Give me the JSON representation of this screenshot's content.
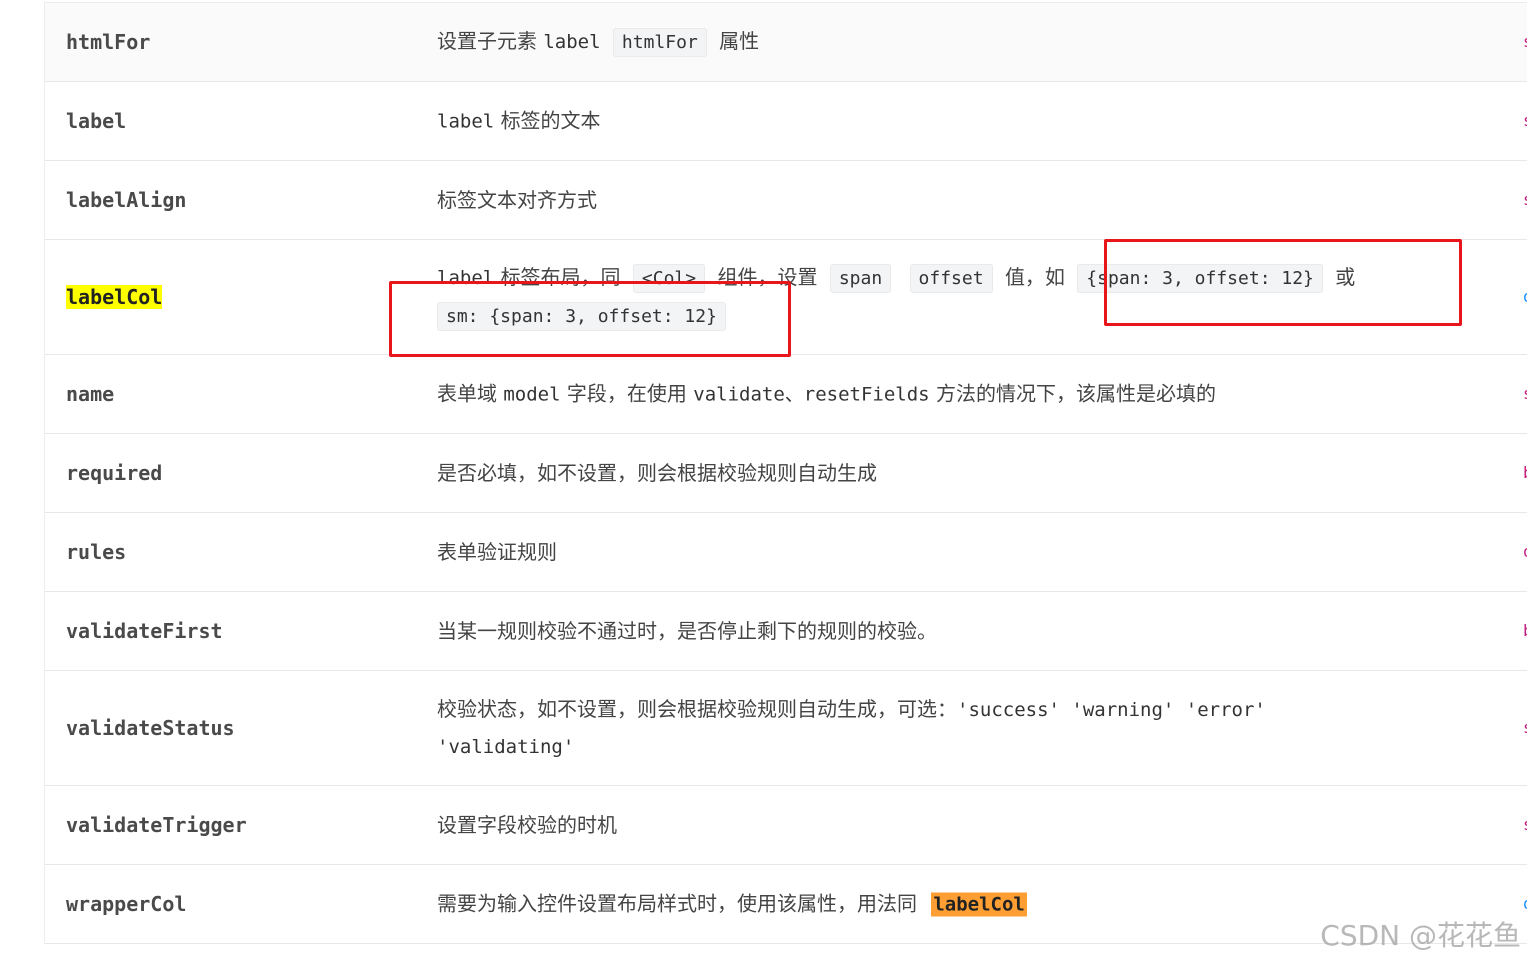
{
  "rows": [
    {
      "prop": "htmlFor",
      "desc": {
        "a": "设置子元素",
        "b": "label",
        "code": "htmlFor",
        "c": "属性"
      },
      "edge": "s"
    },
    {
      "prop": "label",
      "desc": {
        "a": "label",
        "b": "标签的文本"
      },
      "edge": "s"
    },
    {
      "prop": "labelAlign",
      "desc": {
        "a": "标签文本对齐方式"
      },
      "edge": "s"
    },
    {
      "prop": "labelCol",
      "desc": {
        "a": "label",
        "b": "标签布局，同",
        "code1": "<Col>",
        "c": "组件，设置",
        "code2": "span",
        "code3": "offset",
        "d": "值，如",
        "code4": "{span: 3, offset: 12}",
        "e": "或",
        "code5": "sm: {span: 3, offset: 12}"
      },
      "edge": "o"
    },
    {
      "prop": "name",
      "desc": {
        "a": "表单域",
        "b": "model",
        "c": "字段，在使用",
        "d": "validate、resetFields",
        "e": "方法的情况下，该属性是必填的"
      },
      "edge": "s"
    },
    {
      "prop": "required",
      "desc": {
        "a": "是否必填，如不设置，则会根据校验规则自动生成"
      },
      "edge": "b"
    },
    {
      "prop": "rules",
      "desc": {
        "a": "表单验证规则"
      },
      "edge": "o"
    },
    {
      "prop": "validateFirst",
      "desc": {
        "a": "当某一规则校验不通过时，是否停止剩下的规则的校验。"
      },
      "edge": "b"
    },
    {
      "prop": "validateStatus",
      "desc": {
        "a": "校验状态，如不设置，则会根据校验规则自动生成，可选：",
        "b": "'success' 'warning' 'error'",
        "c": "'validating'"
      },
      "edge": "s"
    },
    {
      "prop": "validateTrigger",
      "desc": {
        "a": "设置字段校验的时机"
      },
      "edge": "s"
    },
    {
      "prop": "wrapperCol",
      "desc": {
        "a": "需要为输入控件设置布局样式时，使用该属性，用法同",
        "code": "labelCol"
      },
      "edge": "o"
    }
  ],
  "watermark": "CSDN @花花鱼",
  "colors": {
    "annotation_red": "#e8151b",
    "highlight_yellow": "#ffff00",
    "highlight_orange": "#ff9e32",
    "edge_type_pink": "#c41d7f",
    "edge_type_blue": "#1890ff"
  }
}
